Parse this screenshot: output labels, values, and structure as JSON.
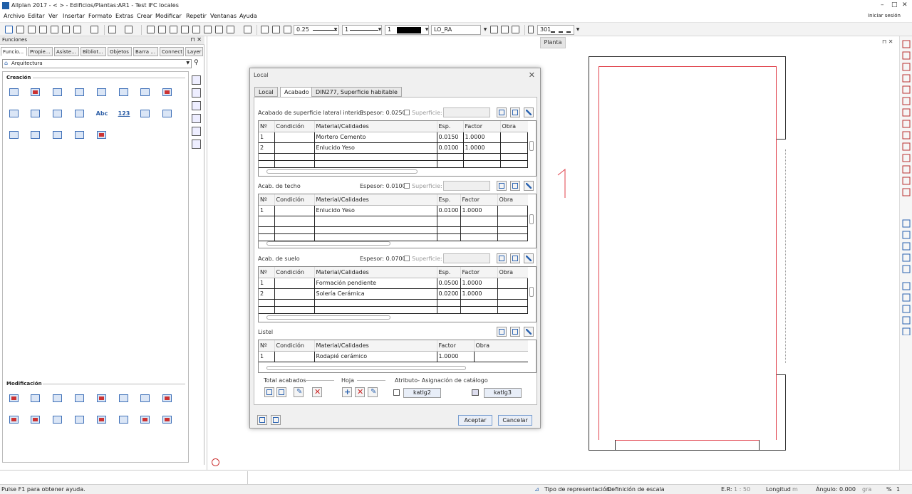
{
  "window": {
    "title": "Allplan 2017 -  <      > - Edificios/Plantas:AR1 - Test IFC locales",
    "controls": [
      "–",
      "□",
      "✕"
    ]
  },
  "menu": {
    "items": [
      "Archivo",
      "Editar",
      "Ver",
      "Insertar",
      "Formato",
      "Extras",
      "Crear",
      "Modificar",
      "Repetir",
      "Ventanas",
      "Ayuda"
    ],
    "login": "Iniciar sesión"
  },
  "toolbar": {
    "pen_thickness": "0.25",
    "line_type": "1",
    "color": "1",
    "layer": "LO_RA",
    "scale_code": "301"
  },
  "panel": {
    "title": "Funciones",
    "tabs": [
      "Funcio...",
      "Propie...",
      "Asiste...",
      "Bibliot...",
      "Objetos",
      "Barra ...",
      "Connect",
      "Layer"
    ],
    "module": "Arquitectura",
    "section_create": "Creación",
    "section_modify": "Modificación",
    "icon_abc": "Abc",
    "icon_123": "123"
  },
  "drawing": {
    "view_label": "Planta"
  },
  "dialog": {
    "title": "Local",
    "tabs": [
      "Local",
      "Acabado",
      "DIN277, Superficie habitable"
    ],
    "active_tab": "Acabado",
    "surface_label": "Superficie:",
    "walls": {
      "label": "Acabado de superficie lateral interior",
      "thickness": "Espesor: 0.0250",
      "headers": [
        "Nº",
        "Condición",
        "Material/Calidades",
        "Esp.",
        "Factor",
        "Obra"
      ],
      "rows": [
        [
          "1",
          "",
          "Mortero Cemento",
          "0.0150",
          "1.0000",
          ""
        ],
        [
          "2",
          "",
          "Enlucido Yeso",
          "0.0100",
          "1.0000",
          ""
        ]
      ]
    },
    "ceiling": {
      "label": "Acab. de techo",
      "thickness": "Espesor: 0.0100",
      "headers": [
        "Nº",
        "Condición",
        "Material/Calidades",
        "Esp.",
        "Factor",
        "Obra"
      ],
      "rows": [
        [
          "1",
          "",
          "Enlucido Yeso",
          "0.0100",
          "1.0000",
          ""
        ]
      ]
    },
    "floor": {
      "label": "Acab. de suelo",
      "thickness": "Espesor: 0.0700",
      "headers": [
        "Nº",
        "Condición",
        "Material/Calidades",
        "Esp.",
        "Factor",
        "Obra"
      ],
      "rows": [
        [
          "1",
          "",
          "Formación pendiente",
          "0.0500",
          "1.0000",
          ""
        ],
        [
          "2",
          "",
          "Solería Cerámica",
          "0.0200",
          "1.0000",
          ""
        ]
      ]
    },
    "skirting": {
      "label": "Listel",
      "headers": [
        "Nº",
        "Condición",
        "Material/Calidades",
        "Factor",
        "Obra"
      ],
      "rows": [
        [
          "1",
          "",
          "Rodapié cerámico",
          "1.0000",
          ""
        ]
      ]
    },
    "groups": {
      "total": "Total acabados",
      "sheet": "Hoja",
      "attr": "Atributo- Asignación de catálogo",
      "cat1": "katlg2",
      "cat2": "katlg3"
    },
    "ok": "Aceptar",
    "cancel": "Cancelar"
  },
  "status": {
    "help": "Pulse F1 para obtener ayuda.",
    "repr_label": "Tipo de representación:",
    "repr_value": "Definición de escala",
    "scale_label": "E.R:",
    "scale_value": "1 : 50",
    "length_label": "Longitud",
    "length_unit": "m",
    "angle_label": "Ángulo:",
    "angle_value": "0.000",
    "angle_unit": "gra",
    "percent_label": "%",
    "percent_value": "1"
  },
  "colors": {
    "accent": "#2b63b0",
    "plan_inner": "#e0404a",
    "delete": "#cc2222"
  }
}
